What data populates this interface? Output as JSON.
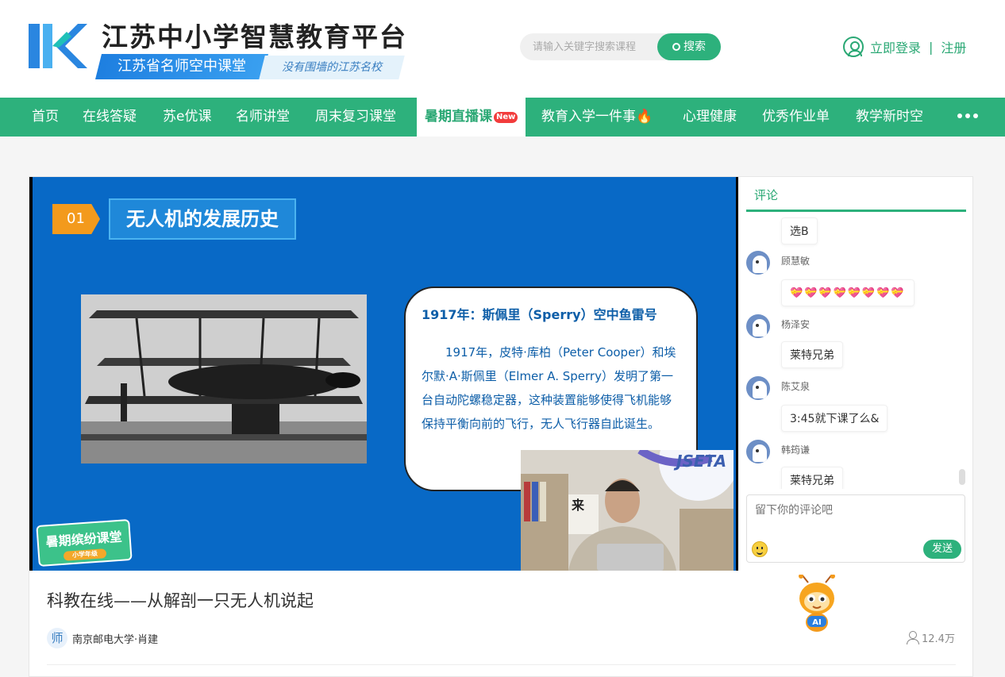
{
  "header": {
    "site_title": "江苏中小学智慧教育平台",
    "sub_title": "江苏省名师空中课堂",
    "slogan": "没有围墙的江苏名校",
    "search_placeholder": "请输入关键字搜索课程",
    "search_button": "搜索",
    "login": "立即登录",
    "separator": "|",
    "register": "注册"
  },
  "nav": {
    "items": [
      "首页",
      "在线答疑",
      "苏e优课",
      "名师讲堂",
      "周末复习课堂",
      "暑期直播课",
      "教育入学一件事",
      "心理健康",
      "优秀作业单",
      "教学新时空"
    ],
    "active_index": 5,
    "new_badge": "New",
    "fire_icon": "🔥"
  },
  "video": {
    "slide_number": "01",
    "slide_title": "无人机的发展历史",
    "textbox_title": "1917年：斯佩里（Sperry）空中鱼雷号",
    "textbox_body": "1917年，皮特·库柏（Peter Cooper）和埃尔默·A·斯佩里（Elmer A. Sperry）发明了第一台自动陀螺稳定器，这种装置能够使得飞机能够保持平衡向前的飞行，无人飞行器自此诞生。",
    "corner_badge": "暑期缤纷课堂",
    "corner_badge_sub": "小学年级",
    "teacher_bg_text": "JSETA",
    "teacher_bg_text2": "来"
  },
  "comments": {
    "tab_label": "评论",
    "items": [
      {
        "name": "",
        "text": "选B"
      },
      {
        "name": "顾慧敏",
        "text": "💝💝💝💝💝💝💝💝"
      },
      {
        "name": "杨泽安",
        "text": "莱特兄弟"
      },
      {
        "name": "陈艾泉",
        "text": "3:45就下课了么&"
      },
      {
        "name": "韩筠谦",
        "text": "莱特兄弟"
      }
    ],
    "input_placeholder": "留下你的评论吧",
    "send_button": "发送"
  },
  "course": {
    "title": "科教在线——从解剖一只无人机说起",
    "author_icon_text": "师",
    "author": "南京邮电大学·肖建",
    "views": "12.4万"
  },
  "colors": {
    "brand_green": "#2db17c",
    "slide_blue": "#0869c6",
    "accent_orange": "#f39a1c"
  }
}
